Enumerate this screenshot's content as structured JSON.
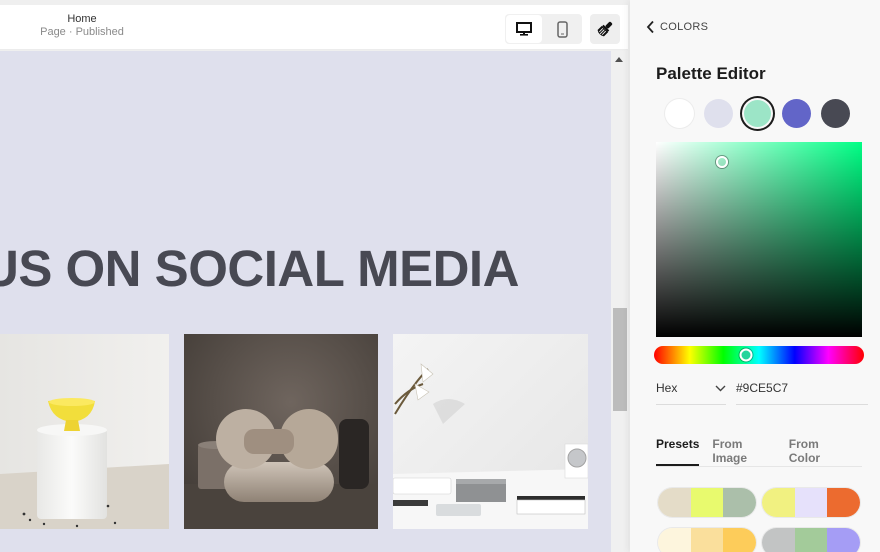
{
  "topbar": {
    "page_title": "Home",
    "page_status": "Page · Published",
    "device_desktop": "desktop-icon",
    "device_mobile": "mobile-icon",
    "design_tool": "paintbrush-icon"
  },
  "canvas": {
    "headline": "US ON SOCIAL MEDIA",
    "photos": [
      {
        "alt": "White pedestal with yellow bowl"
      },
      {
        "alt": "Beige sculptural armchair"
      },
      {
        "alt": "White desk with calla lilies and clock"
      }
    ]
  },
  "panel": {
    "back_label": "COLORS",
    "title": "Palette Editor",
    "swatches": [
      {
        "name": "white",
        "color": "#ffffff"
      },
      {
        "name": "light-lavender",
        "color": "#dfe0ed"
      },
      {
        "name": "mint",
        "color": "#9ce5c7",
        "selected": true
      },
      {
        "name": "indigo",
        "color": "#6265c8"
      },
      {
        "name": "charcoal",
        "color": "#484953"
      }
    ],
    "picker": {
      "saturation": 0.32,
      "value": 0.9,
      "hue_fraction": 0.44
    },
    "format": {
      "selected": "Hex"
    },
    "hex_value": "#9CE5C7",
    "tabs": [
      {
        "label": "Presets",
        "active": true
      },
      {
        "label": "From Image",
        "active": false
      },
      {
        "label": "From Color",
        "active": false
      }
    ],
    "presets": [
      [
        "#e4dcc8",
        "#e8fa6e",
        "#abbfaa"
      ],
      [
        "#f1f181",
        "#e6e1fb",
        "#ec6b2f"
      ],
      [
        "#fdf5dd",
        "#fadf9c",
        "#fdcc5a"
      ],
      [
        "#c2c4c4",
        "#a3cb9a",
        "#a59df5"
      ]
    ]
  }
}
